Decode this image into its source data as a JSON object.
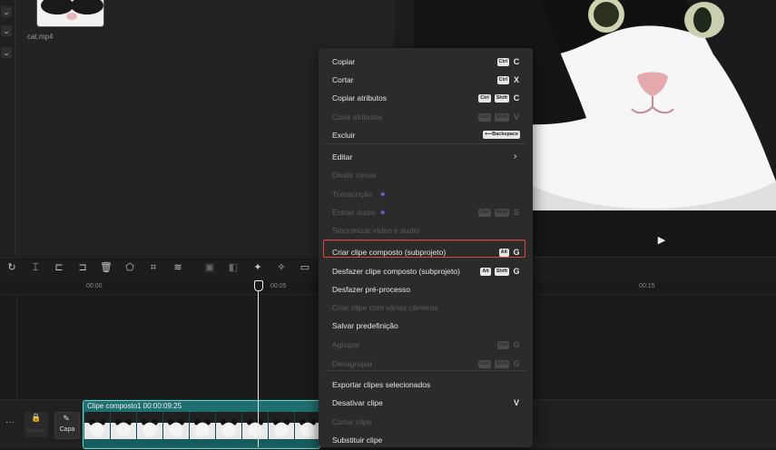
{
  "media": {
    "filename": "cat.mp4"
  },
  "timeline": {
    "ruler": [
      "00:00",
      "00:05",
      "00:15"
    ],
    "track": {
      "lock_label": "Bloquear",
      "cover_label": "Capa"
    },
    "clip": {
      "title": "Clipe composto1   00:00:09:25"
    }
  },
  "context_menu": {
    "items": [
      {
        "label": "Copiar",
        "keys": [
          "Ctrl"
        ],
        "letter": "C",
        "disabled": false
      },
      {
        "label": "Cortar",
        "keys": [
          "Ctrl"
        ],
        "letter": "X",
        "disabled": false
      },
      {
        "label": "Copiar atributos",
        "keys": [
          "Ctrl",
          "Shift"
        ],
        "letter": "C",
        "disabled": false
      },
      {
        "label": "Colar atributos",
        "keys": [
          "Ctrl",
          "Shift"
        ],
        "letter": "V",
        "disabled": true
      },
      {
        "label": "Excluir",
        "keys": [
          "⟵Backspace"
        ],
        "letter": "",
        "disabled": false
      },
      {
        "label": "Editar",
        "keys": [],
        "letter": "",
        "disabled": false,
        "submenu": true
      },
      {
        "label": "Dividir cenas",
        "keys": [],
        "letter": "",
        "disabled": true
      },
      {
        "label": "Transcrição",
        "keys": [],
        "letter": "",
        "disabled": true,
        "premium": true
      },
      {
        "label": "Extrair áudio",
        "keys": [
          "Ctrl",
          "Shift"
        ],
        "letter": "S",
        "disabled": true,
        "premium": true
      },
      {
        "label": "Sincronizar vídeo e áudio",
        "keys": [],
        "letter": "",
        "disabled": true
      },
      {
        "label": "Criar clipe composto (subprojeto)",
        "keys": [
          "Alt"
        ],
        "letter": "G",
        "disabled": false,
        "highlighted": true
      },
      {
        "label": "Desfazer clipe composto (subprojeto)",
        "keys": [
          "Alt",
          "Shift"
        ],
        "letter": "G",
        "disabled": false
      },
      {
        "label": "Desfazer pré-processo",
        "keys": [],
        "letter": "",
        "disabled": false
      },
      {
        "label": "Criar clipe com várias câmeras",
        "keys": [],
        "letter": "",
        "disabled": true
      },
      {
        "label": "Salvar predefinição",
        "keys": [],
        "letter": "",
        "disabled": false
      },
      {
        "label": "Agrupar",
        "keys": [
          "Ctrl"
        ],
        "letter": "G",
        "disabled": true
      },
      {
        "label": "Desagrupar",
        "keys": [
          "Ctrl",
          "Shift"
        ],
        "letter": "G",
        "disabled": true
      },
      {
        "label": "Exportar clipes selecionados",
        "keys": [],
        "letter": "",
        "disabled": false
      },
      {
        "label": "Desativar clipe",
        "keys": [],
        "letter": "V",
        "disabled": false
      },
      {
        "label": "Cortar clipe",
        "keys": [],
        "letter": "",
        "disabled": true
      },
      {
        "label": "Substituir clipe",
        "keys": [],
        "letter": "",
        "disabled": false
      }
    ]
  }
}
